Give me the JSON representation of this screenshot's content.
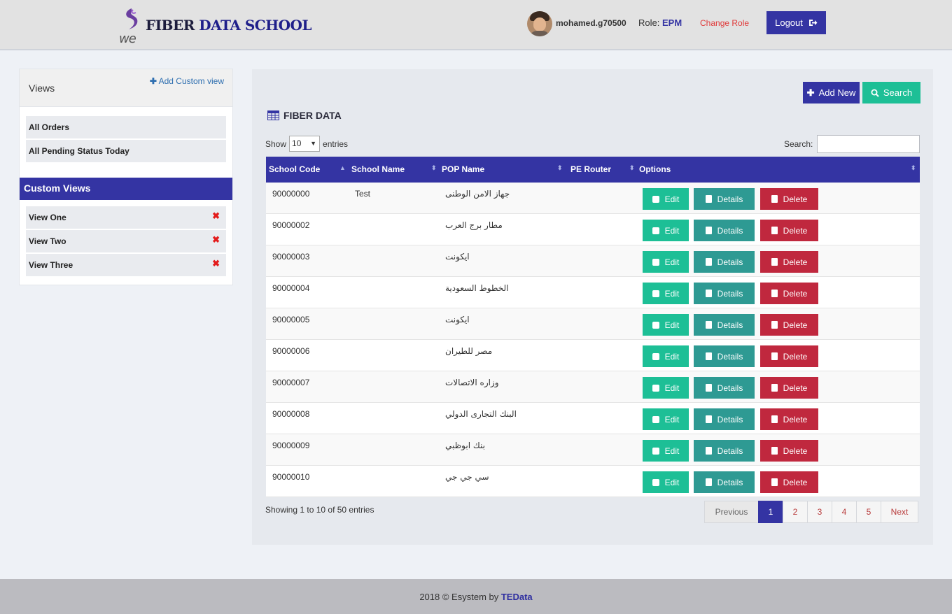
{
  "header": {
    "logo_text_1": "FIBER",
    "logo_text_2": "DATA SCHOOL",
    "logo_we": "we",
    "username": "mohamed.g70500",
    "role_label": "Role:",
    "role_value": "EPM",
    "change_role": "Change Role",
    "logout": "Logout"
  },
  "sidebar": {
    "views_title": "Views",
    "add_custom_view": "Add Custom view",
    "items": [
      "All Orders",
      "All Pending Status Today"
    ],
    "custom_title": "Custom Views",
    "custom_items": [
      "View One",
      "View Two",
      "View Three"
    ]
  },
  "main": {
    "add_new": "Add New",
    "search_btn": "Search",
    "section_title": "FIBER DATA",
    "show_label": "Show",
    "entries_label": "entries",
    "length_value": "10",
    "search_label": "Search:",
    "columns": [
      "School Code",
      "School Name",
      "POP Name",
      "PE Router",
      "Options"
    ],
    "rows": [
      {
        "code": "90000000",
        "school": "Test",
        "pop": "جهاز الامن الوطنى",
        "router": ""
      },
      {
        "code": "90000002",
        "school": "",
        "pop": "مطار برج العرب",
        "router": ""
      },
      {
        "code": "90000003",
        "school": "",
        "pop": "ايكونت",
        "router": ""
      },
      {
        "code": "90000004",
        "school": "",
        "pop": "الخطوط السعودية",
        "router": ""
      },
      {
        "code": "90000005",
        "school": "",
        "pop": "ايكونت",
        "router": ""
      },
      {
        "code": "90000006",
        "school": "",
        "pop": "مصر للطيران",
        "router": ""
      },
      {
        "code": "90000007",
        "school": "",
        "pop": "وزاره الاتصالات",
        "router": ""
      },
      {
        "code": "90000008",
        "school": "",
        "pop": "البنك التجارى الدولي",
        "router": ""
      },
      {
        "code": "90000009",
        "school": "",
        "pop": "بنك ابوظبي",
        "router": ""
      },
      {
        "code": "90000010",
        "school": "",
        "pop": "سي جي جي",
        "router": ""
      }
    ],
    "btn_edit": "Edit",
    "btn_details": "Details",
    "btn_delete": "Delete",
    "info": "Showing 1 to 10 of 50 entries",
    "pager": {
      "prev": "Previous",
      "pages": [
        "1",
        "2",
        "3",
        "4",
        "5"
      ],
      "next": "Next",
      "active": "1"
    }
  },
  "footer": {
    "text": "2018 © Esystem by",
    "brand": "TEData"
  },
  "colors": {
    "primary": "#3434a3",
    "edit": "#1dbf96",
    "details": "#2e9a93",
    "delete": "#c0283e",
    "danger_text": "#e03a3a"
  }
}
